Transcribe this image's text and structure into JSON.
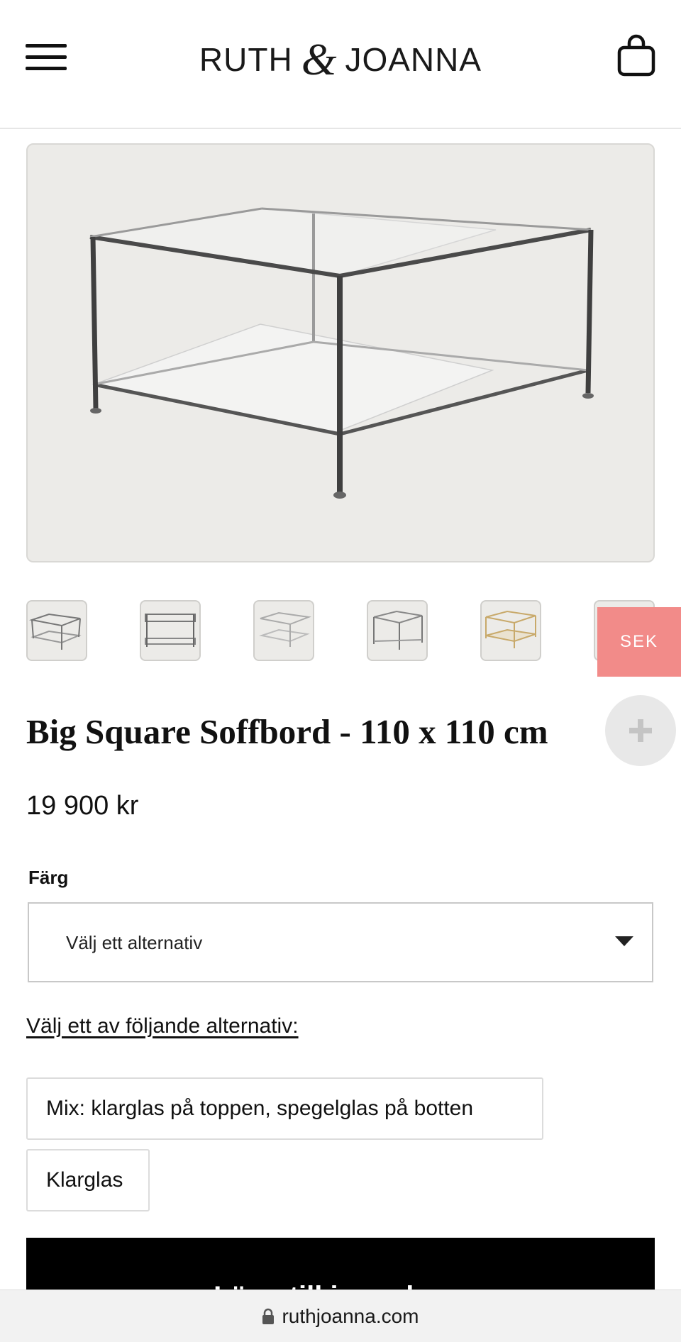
{
  "header": {
    "brand_left": "RUTH",
    "brand_amp": "&",
    "brand_right": "JOANNA",
    "menu_icon": "hamburger-menu-icon",
    "cart_icon": "shopping-bag-icon"
  },
  "gallery": {
    "main_image": "glass-coffee-table-chrome-frame",
    "thumbnails": [
      "table-chrome-1",
      "table-chrome-2",
      "table-chrome-3",
      "table-chrome-4",
      "table-brass-5",
      "table-chrome-6"
    ]
  },
  "currency_button": {
    "label": "SEK"
  },
  "plus_button": {
    "icon": "plus-icon"
  },
  "product": {
    "title": "Big Square Soffbord - 110 x 110 cm",
    "price": "19 900 kr"
  },
  "color_select": {
    "label": "Färg",
    "value": "Välj ett alternativ"
  },
  "options": {
    "link_label": "Välj ett av följande alternativ:",
    "items": [
      "Mix: klarglas på toppen, spegelglas på botten",
      "Klarglas"
    ]
  },
  "add_to_cart": {
    "label": "Lägg till i varukorg"
  },
  "browser": {
    "url": "ruthjoanna.com",
    "lock_icon": "lock-icon"
  },
  "colors": {
    "accent_sek": "#f28b89",
    "button_black": "#000000",
    "image_bg": "#ecebe8"
  }
}
